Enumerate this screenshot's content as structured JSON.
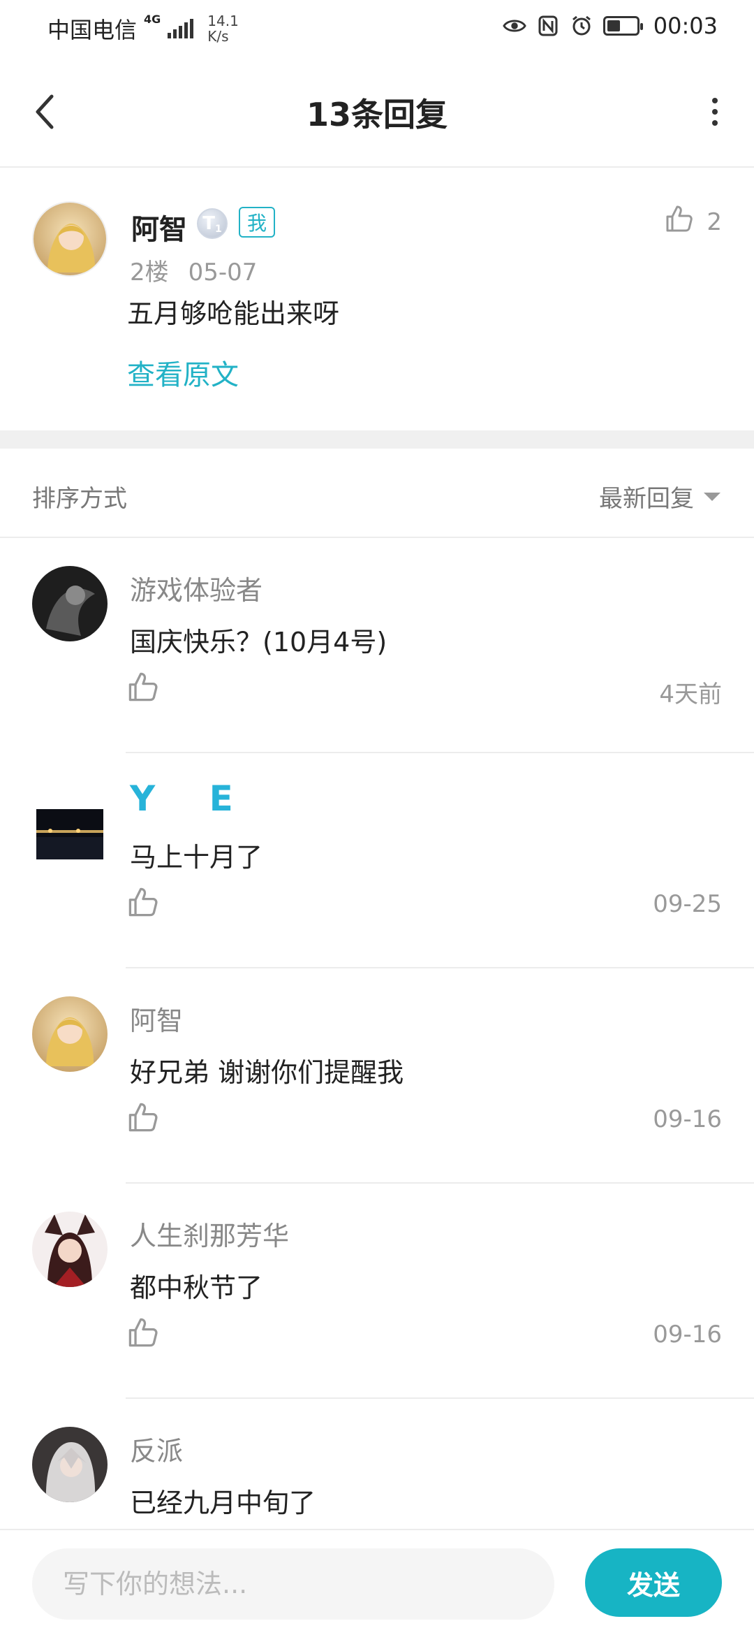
{
  "status_bar": {
    "carrier": "中国电信",
    "network_type": "4G",
    "speed_value": "14.1",
    "speed_unit": "K/s",
    "time": "00:03",
    "icons": [
      "signal-icon",
      "eye-icon",
      "nfc-icon",
      "alarm-icon",
      "battery-icon"
    ]
  },
  "header": {
    "title": "13条回复",
    "back_icon": "chevron-left-icon",
    "more_icon": "more-vertical-icon"
  },
  "original_post": {
    "author": "阿智",
    "level_badge": "T",
    "level_number": "1",
    "me_badge": "我",
    "floor": "2楼",
    "date": "05-07",
    "content": "五月够呛能出来呀",
    "view_original": "查看原文",
    "likes": "2"
  },
  "sort": {
    "label": "排序方式",
    "value": "最新回复"
  },
  "replies": [
    {
      "name": "游戏体验者",
      "text": "国庆快乐？(10月4号)",
      "time": "4天前"
    },
    {
      "name": "Y E",
      "text": "马上十月了",
      "time": "09-25"
    },
    {
      "name": "阿智",
      "text": "好兄弟 谢谢你们提醒我",
      "time": "09-16"
    },
    {
      "name": "人生刹那芳华",
      "text": "都中秋节了",
      "time": "09-16"
    },
    {
      "name": "反派",
      "text": "已经九月中旬了",
      "time": ""
    }
  ],
  "composer": {
    "placeholder": "写下你的想法...",
    "send_label": "发送"
  },
  "colors": {
    "accent": "#17b4c4",
    "link": "#22b2c6",
    "name_highlight": "#27b3d9"
  }
}
